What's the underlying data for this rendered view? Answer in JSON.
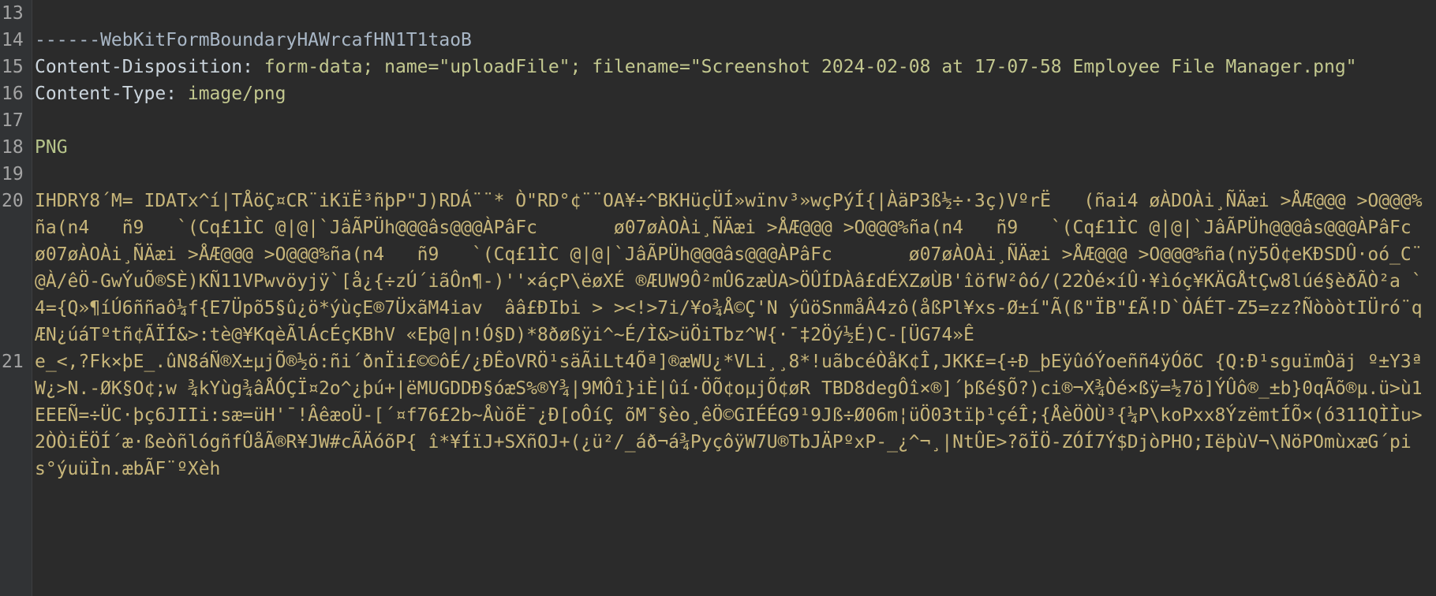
{
  "editor": {
    "lines": [
      {
        "n": "13",
        "text": ""
      },
      {
        "n": "14",
        "text": "------WebKitFormBoundaryHAWrcafHN1T1taoB"
      },
      {
        "n": "15",
        "key": "Content-Disposition:",
        "text": " form-data; name=\"uploadFile\"; filename=\"Screenshot 2024-02-08 at 17-07-58 Employee File Manager.png\""
      },
      {
        "n": "16",
        "key": "Content-Type:",
        "text": " image/png"
      },
      {
        "n": "17",
        "text": ""
      },
      {
        "n": "18",
        "text": "PNG"
      },
      {
        "n": "19",
        "text": ""
      },
      {
        "n": "20",
        "text": "IHDRY8´M= IDATx^í|TÅöÇ¤CR¨iKïË³ñþP\"J)RDÁ¨¨* Ò\"RD°¢¨¨OA¥÷^BKHüçÜÍ»wïnv³»wçPýÍ{|ÀäP3ß½÷·3ç)VºrË   (ñai4 øÀDOÀi¸ÑÄæi >ÅÆ@@@ >O@@@%ña(n4   ñ9   `(Cq£1ÌC @|@|`JâÃPÜh@@@âs@@@ÀPâFc       ø07øÀOÀi¸ÑÄæi >ÅÆ@@@ >O@@@%ña(n4   ñ9   `(Cq£1ÌC @|@|`JâÃPÜh@@@âs@@@ÀPâFc       ø07øÀOÀi¸ÑÄæi >ÅÆ@@@ >O@@@%ña(n4   ñ9   `(Cq£1ÌC @|@|`JâÃPÜh@@@âs@@@ÀPâFc       ø07øÀOÀi¸ÑÄæi >ÅÆ@@@ >O@@@%ña(nÿ5Ö¢eKÐSDÛ·oó_C¨ @À/êÖ-GwÝuÕ®SÈ)KÑ11VPwvöyjÿ`[å¿{÷zÚ´iãÔn¶-)''×áçP\\ëøXÉ ®ÆUW9Ô²mÛ6zæÙA>ÖÛÍDÀâ£dÉXZøÙB'îöfW²ôó/(22Òé×íÛ·¥ìóç¥KÄGÅtÇw8lúé§èðÃÒ²a `4={Q»¶íÚ6ññaô¼f{E7Üpõ5§û¿ö*ýùçE®7ÜxãM4iav  ââ£ÐIbi > ><!>7i/¥o¾Å©Ç'N ýûöSnmåÂ4zô(åßPl¥xs-Ø±í\"Ã(ß\"ÏB\"£Ã!D`ÒÁÉT-Z5=zz?ÑòòòtIÜró¨qÆN¿úáTºtñ¢ÃÏÍ&>:tè@¥KqèÃlÁcÉçKBhV «Eþ@|n!Ó§D)*8ðøßÿi^~É/Ì&>üÖiTbz^W{·¯‡2Öý½É)C-[ÜG74»Ê"
      },
      {
        "n": "21",
        "text": "e_<,?Fk×þE_.ûN8áÑ®X±µjÕ®½ö:ñi´ðnÏi£©©ôÉ/¿ÐÊoVRÖ¹säÃiLt4Õª]®æWU¿*VLi¸¸8*!uãbcéÒåK¢Î,JKK£={÷Ð_þEÿûóÝoeññ4ÿÓõC {Q:Ð¹sguïmÒäj º±Y3ªW¿>N.-ØK§O¢;w ¾kYùg¾âÅÓÇÏ¤2o^¿þú+|ëMUGDDÐ§óæS%®Y¾|9MÔî}iÈ|ûí·ÖÕ¢oµjÕ¢øR TBD8degÔî×®]´þßé§Õ?)ci®¬X¾Òé×ßÿ=½7ö]ÝÛô®_±b}0qÃõ®µ.ü>ù1EEEÑ=÷ÜC·þç6JIIi:sæ=üH'¯!ÂêæoÜ-[´¤f76£2b~ÅùõË¯¿Ð[oÔíÇ õM¯§èo¸êÖ©GIÉÉG9¹9Jß÷Ø06m¦üÖ03tïþ¹çéÎ;{ÅèÖÒÙ³{¼P\\koPxx8ÝzëmtÍÕ×(ó311QÌÌu>2ÒÒiËÖÍ´æ·ßeòñlógñfÛåÃ®R¥JW#cÃÄóõP{ î*¥ÍïJ+SXñOJ+(¿ü²/_áð¬á¾PyçôÿW7U®TbJÄPºxP-_¿^¬¸|NtÛE>?õÏÖ-ZÓÍ7Ý$DjòPHO;IëþùV¬\\NöPOmùxæG´pis°ýuüÌn.æbÃF¨ºXèh"
      }
    ]
  }
}
